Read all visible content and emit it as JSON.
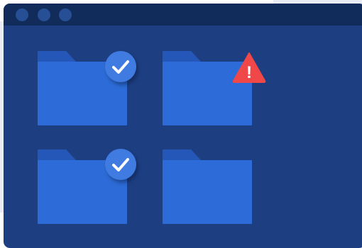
{
  "window": {
    "controls": [
      "close-dot",
      "minimize-dot",
      "maximize-dot"
    ]
  },
  "folders": [
    {
      "status": "synced",
      "icon": "checkmark-icon"
    },
    {
      "status": "error",
      "icon": "warning-icon",
      "symbol": "!"
    },
    {
      "status": "synced",
      "icon": "checkmark-icon"
    },
    {
      "status": "none"
    }
  ],
  "colors": {
    "window_bg": "#1d3f82",
    "titlebar": "#112b5a",
    "folder_front": "#2d6cd8",
    "folder_tab": "#2557b8",
    "check_badge": "#3f7be0",
    "warning": "#f04848"
  }
}
